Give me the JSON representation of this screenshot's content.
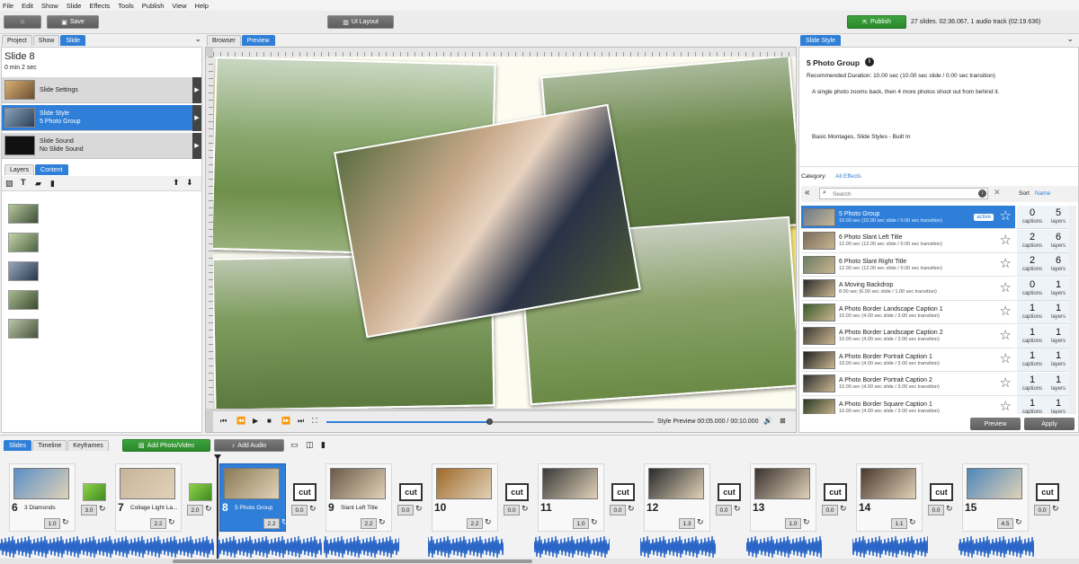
{
  "menu": [
    "File",
    "Edit",
    "Show",
    "Slide",
    "Effects",
    "Tools",
    "Publish",
    "View",
    "Help"
  ],
  "toolbar": {
    "save": "Save",
    "ui_layout": "UI Layout",
    "publish": "Publish",
    "status": "27 slides. 02:36.067, 1 audio track (02:19.636)"
  },
  "left_tabs": [
    "Project",
    "Show",
    "Slide"
  ],
  "slide": {
    "title": "Slide 8",
    "duration": "0 min 2 sec"
  },
  "slide_items": [
    {
      "name": "Slide Settings",
      "sub": ""
    },
    {
      "name": "Slide Style",
      "sub": "5 Photo Group"
    },
    {
      "name": "Slide Sound",
      "sub": "No Slide Sound"
    }
  ],
  "layer_tabs": [
    "Layers",
    "Content"
  ],
  "preview_tabs": [
    "Browser",
    "Preview"
  ],
  "playback": {
    "label": "Style Preview 00:05.000 / 00:10.000",
    "progress": 0.5
  },
  "style_panel": {
    "tab": "Slide Style",
    "name": "5 Photo Group",
    "recommended": "Recommended Duration: 10.00 sec (10.00 sec slide / 0.00 sec transition)",
    "description": "A single photo zooms back, then 4 more photos shoot out from behind it.",
    "tags": "Basic Montages, Slide Styles - Built In",
    "category_label": "Category:",
    "category_value": "All Effects",
    "search_placeholder": "Search",
    "sort_label": "Sort",
    "sort_value": "Name",
    "active_badge": "active",
    "preview_btn": "Preview",
    "apply_btn": "Apply",
    "captions_label": "captions",
    "layers_label": "layers",
    "styles": [
      {
        "name": "5 Photo Group",
        "dur": "10.00 sec (10.00 sec slide / 0.00 sec transition)",
        "captions": "0",
        "layers": "5"
      },
      {
        "name": "6 Photo Slant Left Title",
        "dur": "12.00 sec (12.00 sec slide / 0.00 sec transition)",
        "captions": "2",
        "layers": "6"
      },
      {
        "name": "6 Photo Slant Right Title",
        "dur": "12.00 sec (12.00 sec slide / 0.00 sec transition)",
        "captions": "2",
        "layers": "6"
      },
      {
        "name": "A Moving Backdrop",
        "dur": "8.00 sec (6.00 sec slide / 1.00 sec transition)",
        "captions": "0",
        "layers": "1"
      },
      {
        "name": "A Photo Border Landscape Caption 1",
        "dur": "10.00 sec (4.00 sec slide / 3.00 sec transition)",
        "captions": "1",
        "layers": "1"
      },
      {
        "name": "A Photo Border Landscape Caption 2",
        "dur": "10.00 sec (4.00 sec slide / 3.00 sec transition)",
        "captions": "1",
        "layers": "1"
      },
      {
        "name": "A Photo Border Portrait Caption 1",
        "dur": "10.00 sec (4.00 sec slide / 3.00 sec transition)",
        "captions": "1",
        "layers": "1"
      },
      {
        "name": "A Photo Border Portrait Caption 2",
        "dur": "10.00 sec (4.00 sec slide / 3.00 sec transition)",
        "captions": "1",
        "layers": "1"
      },
      {
        "name": "A Photo Border Square Caption 1",
        "dur": "10.00 sec (4.00 sec slide / 3.00 sec transition)",
        "captions": "1",
        "layers": "1"
      }
    ]
  },
  "timeline": {
    "tabs": [
      "Slides",
      "Timeline",
      "Keyframes"
    ],
    "add_photo": "Add Photo/Video",
    "add_audio": "Add Audio",
    "cut_label": "cut",
    "slides": [
      {
        "num": "6",
        "name": "3 Diamonds",
        "dur": "1.0",
        "trans": "3.0",
        "thumb": "#5b8fc4"
      },
      {
        "num": "7",
        "name": "Collage Light La...",
        "dur": "2.2",
        "trans": "2.0",
        "thumb": "#c9b39b"
      },
      {
        "num": "8",
        "name": "5 Photo Group",
        "dur": "2.2",
        "trans": "0.0",
        "thumb": "#8a7a55"
      },
      {
        "num": "9",
        "name": "Slant Left Title",
        "dur": "2.2",
        "trans": "0.0",
        "thumb": "#6a5a48"
      },
      {
        "num": "10",
        "name": "",
        "dur": "2.2",
        "trans": "0.0",
        "thumb": "#a06a2a"
      },
      {
        "num": "11",
        "name": "",
        "dur": "1.0",
        "trans": "0.0",
        "thumb": "#3a3a3a"
      },
      {
        "num": "12",
        "name": "",
        "dur": "1.3",
        "trans": "0.0",
        "thumb": "#2a2a2a"
      },
      {
        "num": "13",
        "name": "",
        "dur": "1.0",
        "trans": "0.0",
        "thumb": "#3b3330"
      },
      {
        "num": "14",
        "name": "",
        "dur": "1.1",
        "trans": "0.0",
        "thumb": "#4a3a2e"
      },
      {
        "num": "15",
        "name": "",
        "dur": "4.5",
        "trans": "0.0",
        "thumb": "#4f86b8"
      }
    ]
  },
  "colors": {
    "accent": "#2f7fd8",
    "publish": "#2f942f",
    "waveform": "#2a66c8"
  }
}
